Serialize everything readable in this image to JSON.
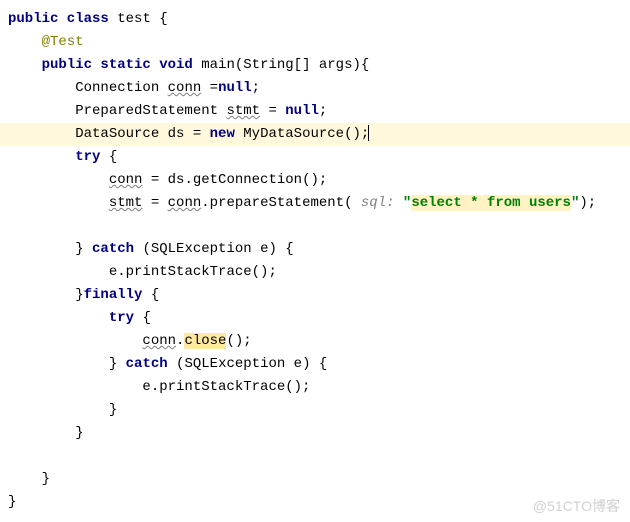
{
  "code": {
    "class_decl_pre": "public class",
    "class_name": "test",
    "brace_open": "{",
    "anno": "@Test",
    "main_pre": "public static void",
    "main_name": "main",
    "main_params": "(String[] args){",
    "conn_decl_type": "Connection ",
    "conn_var": "conn",
    "conn_assign_pre": " =",
    "null_kw": "null",
    "semi": ";",
    "stmt_decl_type": "PreparedStatement ",
    "stmt_var": "stmt",
    "stmt_assign": " = ",
    "ds_decl_pre": "DataSource ds = ",
    "new_kw": "new",
    "ds_ctor": " MyDataSource();",
    "try_kw": "try",
    "conn_assign_line_pre": " = ds.getConnection();",
    "stmt_assign_pre": " = ",
    "conn_ref": "conn",
    "prep_call": ".prepareStatement( ",
    "param_hint": "sql: ",
    "sql_open": "\"",
    "sql_body": "select * from users",
    "sql_close": "\"",
    "prep_end": ");",
    "catch_kw": "catch",
    "exc_type": " (SQLException e) {",
    "print_stack": "e.printStackTrace();",
    "finally_kw": "finally",
    "close_call_pre": ".",
    "close_method": "close",
    "close_call_post": "();",
    "brace_close": "}"
  },
  "watermark": "@51CTO博客"
}
